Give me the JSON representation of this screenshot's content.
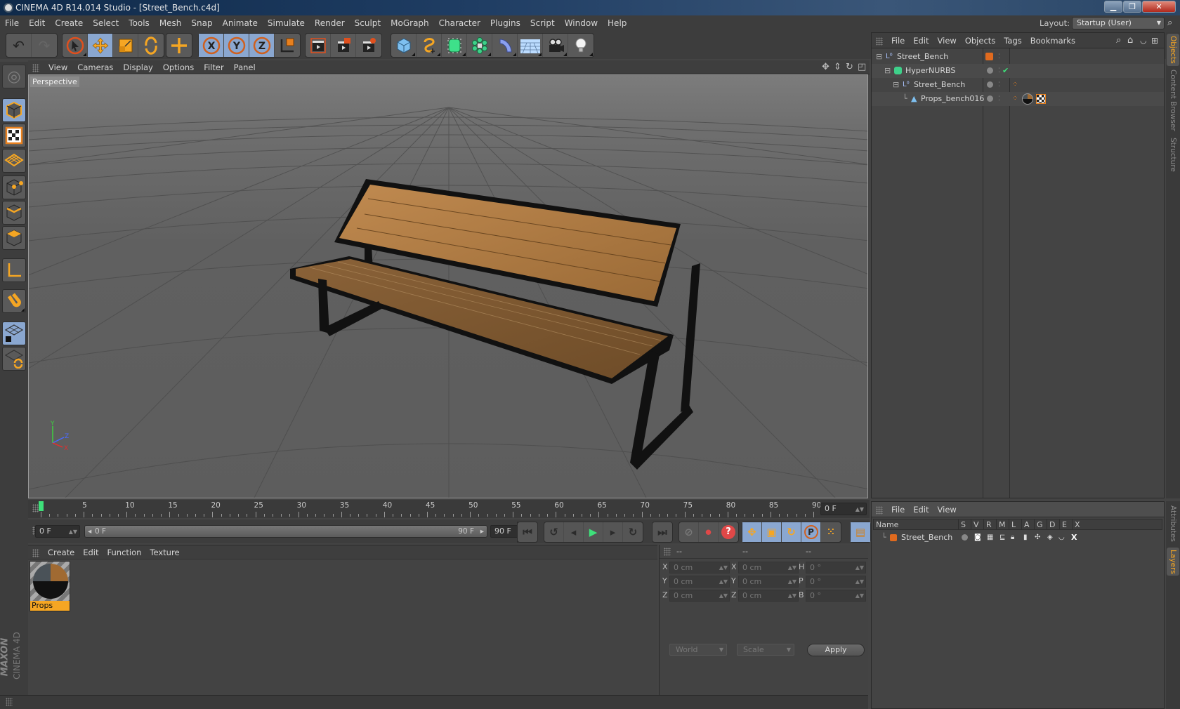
{
  "window": {
    "title": "CINEMA 4D R14.014 Studio - [Street_Bench.c4d]",
    "controls": [
      "minimize",
      "maximize",
      "close"
    ]
  },
  "menubar": {
    "items": [
      "File",
      "Edit",
      "Create",
      "Select",
      "Tools",
      "Mesh",
      "Snap",
      "Animate",
      "Simulate",
      "Render",
      "Sculpt",
      "MoGraph",
      "Character",
      "Plugins",
      "Script",
      "Window",
      "Help"
    ],
    "layout_label": "Layout:",
    "layout_value": "Startup (User)"
  },
  "toolbar": {
    "groups": [
      [
        "undo-icon",
        "redo-icon"
      ],
      [
        "live-selection-icon",
        "move-icon",
        "scale-icon",
        "rotate-icon"
      ],
      [
        "recent-tool-icon"
      ],
      [
        "x-axis-lock-icon",
        "y-axis-lock-icon",
        "z-axis-lock-icon",
        "coordinate-system-icon"
      ],
      [
        "render-view-icon",
        "render-picture-viewer-icon",
        "render-settings-icon"
      ],
      [
        "cube-icon",
        "spline-pen-icon",
        "subdivision-surface-icon",
        "array-cloner-icon",
        "deformer-bend-icon",
        "floor-environment-icon",
        "camera-icon",
        "light-icon"
      ]
    ]
  },
  "left_tools": [
    "make-editable-icon",
    "model-mode-icon",
    "texture-mode-icon",
    "workplane-mode-icon",
    "points-mode-icon",
    "edges-mode-icon",
    "polygons-mode-icon",
    "axis-mode-icon",
    "snap-magnet-icon",
    "workplane-lock-icon",
    "workplane-rotate-icon"
  ],
  "viewport": {
    "menu": [
      "View",
      "Cameras",
      "Display",
      "Options",
      "Filter",
      "Panel"
    ],
    "camera_label": "Perspective",
    "nav_icons": [
      "move-view-icon",
      "zoom-view-icon",
      "rotate-view-icon",
      "maximize-view-icon"
    ],
    "axis_labels": {
      "x": "X",
      "y": "Y",
      "z": "Z"
    }
  },
  "timeline": {
    "ticks": [
      "0",
      "5",
      "10",
      "15",
      "20",
      "25",
      "30",
      "35",
      "40",
      "45",
      "50",
      "55",
      "60",
      "65",
      "70",
      "75",
      "80",
      "85",
      "90"
    ],
    "current_frame_field": "0 F",
    "start_field": "0 F",
    "range_start": "0 F",
    "range_end": "90 F",
    "end_field": "90 F",
    "playhead_frame": 0
  },
  "playback": {
    "buttons": [
      "go-to-start-icon",
      "previous-key-icon",
      "previous-frame-icon",
      "play-icon",
      "next-frame-icon",
      "next-key-icon",
      "go-to-end-icon"
    ],
    "record_buttons": [
      "autokey-icon",
      "record-active-objects-icon",
      "keyframe-selection-icon"
    ],
    "key_buttons": [
      "key-position-icon",
      "key-scale-icon",
      "key-rotation-icon",
      "key-parameter-icon",
      "key-pla-icon"
    ],
    "timeline_button": "timeline-window-icon"
  },
  "materials": {
    "menu": [
      "Create",
      "Edit",
      "Function",
      "Texture"
    ],
    "items": [
      {
        "name": "Props"
      }
    ]
  },
  "coordinates": {
    "headers": [
      "--",
      "--",
      "--"
    ],
    "rows": [
      {
        "l1": "X",
        "v1": "0 cm",
        "l2": "X",
        "v2": "0 cm",
        "l3": "H",
        "v3": "0 °"
      },
      {
        "l1": "Y",
        "v1": "0 cm",
        "l2": "Y",
        "v2": "0 cm",
        "l3": "P",
        "v3": "0 °"
      },
      {
        "l1": "Z",
        "v1": "0 cm",
        "l2": "Z",
        "v2": "0 cm",
        "l3": "B",
        "v3": "0 °"
      }
    ],
    "space_dropdown": "World",
    "mode_dropdown": "Scale",
    "apply_label": "Apply"
  },
  "objects_panel": {
    "menu": [
      "File",
      "Edit",
      "View",
      "Objects",
      "Tags",
      "Bookmarks"
    ],
    "tree": [
      {
        "name": "Street_Bench",
        "type": "null-object-icon",
        "depth": 0
      },
      {
        "name": "HyperNURBS",
        "type": "hypernurbs-icon",
        "depth": 1
      },
      {
        "name": "Street_Bench",
        "type": "null-object-icon",
        "depth": 2
      },
      {
        "name": "Props_bench016",
        "type": "polygon-object-icon",
        "depth": 3
      }
    ]
  },
  "side_tabs_top": [
    {
      "label": "Objects",
      "active": true
    },
    {
      "label": "Content Browser",
      "active": false
    },
    {
      "label": "Structure",
      "active": false
    }
  ],
  "side_tabs_bottom": [
    {
      "label": "Attributes",
      "active": false
    },
    {
      "label": "Layers",
      "active": true
    }
  ],
  "layers_panel": {
    "menu": [
      "File",
      "Edit",
      "View"
    ],
    "columns": [
      "Name",
      "S",
      "V",
      "R",
      "M",
      "L",
      "A",
      "G",
      "D",
      "E",
      "X"
    ],
    "rows": [
      {
        "name": "Street_Bench",
        "color": "#e06a1e"
      }
    ]
  },
  "brand": {
    "maxon": "MAXON",
    "product": "CINEMA 4D"
  },
  "colors": {
    "accent_orange": "#f5a623",
    "active_blue": "#8aa7d0",
    "play_green": "#3ee07a",
    "record_red": "#e04848",
    "layer_color": "#e06a1e"
  }
}
